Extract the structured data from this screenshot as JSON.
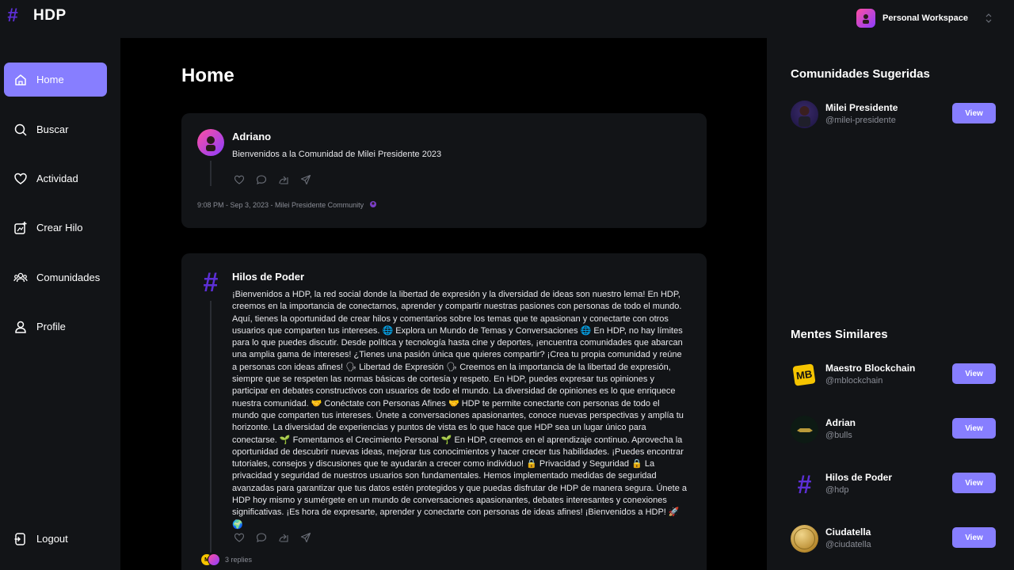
{
  "app": {
    "name": "HDP",
    "logo_glyph": "#"
  },
  "workspace": {
    "name": "Personal Workspace"
  },
  "sidebar": {
    "items": [
      {
        "label": "Home",
        "icon": "home-icon",
        "active": true
      },
      {
        "label": "Buscar",
        "icon": "search-icon"
      },
      {
        "label": "Actividad",
        "icon": "heart-icon"
      },
      {
        "label": "Crear Hilo",
        "icon": "create-thread-icon"
      },
      {
        "label": "Comunidades",
        "icon": "communities-icon"
      },
      {
        "label": "Profile",
        "icon": "profile-icon"
      }
    ],
    "logout_label": "Logout"
  },
  "main": {
    "title": "Home",
    "posts": [
      {
        "author": "Adriano",
        "text": "Bienvenidos a la Comunidad de Milei Presidente 2023",
        "meta": "9:08 PM - Sep 3, 2023 - Milei Presidente Community"
      },
      {
        "author": "Hilos de Poder",
        "avatar_glyph": "#",
        "text": "¡Bienvenidos a HDP, la red social donde la libertad de expresión y la diversidad de ideas son nuestro lema! En HDP, creemos en la importancia de conectarnos, aprender y compartir nuestras pasiones con personas de todo el mundo. Aquí, tienes la oportunidad de crear hilos y comentarios sobre los temas que te apasionan y conectarte con otros usuarios que comparten tus intereses. 🌐 Explora un Mundo de Temas y Conversaciones 🌐 En HDP, no hay límites para lo que puedes discutir. Desde política y tecnología hasta cine y deportes, ¡encuentra comunidades que abarcan una amplia gama de intereses! ¿Tienes una pasión única que quieres compartir? ¡Crea tu propia comunidad y reúne a personas con ideas afines! 🗣 Libertad de Expresión 🗣 Creemos en la importancia de la libertad de expresión, siempre que se respeten las normas básicas de cortesía y respeto. En HDP, puedes expresar tus opiniones y participar en debates constructivos con usuarios de todo el mundo. La diversidad de opiniones es lo que enriquece nuestra comunidad. 🤝 Conéctate con Personas Afines 🤝 HDP te permite conectarte con personas de todo el mundo que comparten tus intereses. Únete a conversaciones apasionantes, conoce nuevas perspectivas y amplía tu horizonte. La diversidad de experiencias y puntos de vista es lo que hace que HDP sea un lugar único para conectarse. 🌱 Fomentamos el Crecimiento Personal 🌱 En HDP, creemos en el aprendizaje continuo. Aprovecha la oportunidad de descubrir nuevas ideas, mejorar tus conocimientos y hacer crecer tus habilidades. ¡Puedes encontrar tutoriales, consejos y discusiones que te ayudarán a crecer como individuo! 🔒 Privacidad y Seguridad 🔒 La privacidad y seguridad de nuestros usuarios son fundamentales. Hemos implementado medidas de seguridad avanzadas para garantizar que tus datos estén protegidos y que puedas disfrutar de HDP de manera segura. Únete a HDP hoy mismo y sumérgete en un mundo de conversaciones apasionantes, debates interesantes y conexiones significativas. ¡Es hora de expresarte, aprender y conectarte con personas de ideas afines! ¡Bienvenidos a HDP! 🚀🌍",
        "replies": "3 replies"
      }
    ]
  },
  "rightbar": {
    "communities_title": "Comunidades Sugeridas",
    "communities": [
      {
        "name": "Milei Presidente",
        "handle": "@milei-presidente",
        "button": "View"
      }
    ],
    "people_title": "Mentes Similares",
    "people": [
      {
        "name": "Maestro Blockchain",
        "handle": "@mblockchain",
        "button": "View",
        "avatar_text": "MB"
      },
      {
        "name": "Adrian",
        "handle": "@bulls",
        "button": "View"
      },
      {
        "name": "Hilos de Poder",
        "handle": "@hdp",
        "button": "View",
        "avatar_text": "#"
      },
      {
        "name": "Ciudatella",
        "handle": "@ciudatella",
        "button": "View"
      }
    ]
  },
  "colors": {
    "accent": "#877eff",
    "brand": "#5c2fd6",
    "panel": "#121417",
    "background": "#000000"
  }
}
